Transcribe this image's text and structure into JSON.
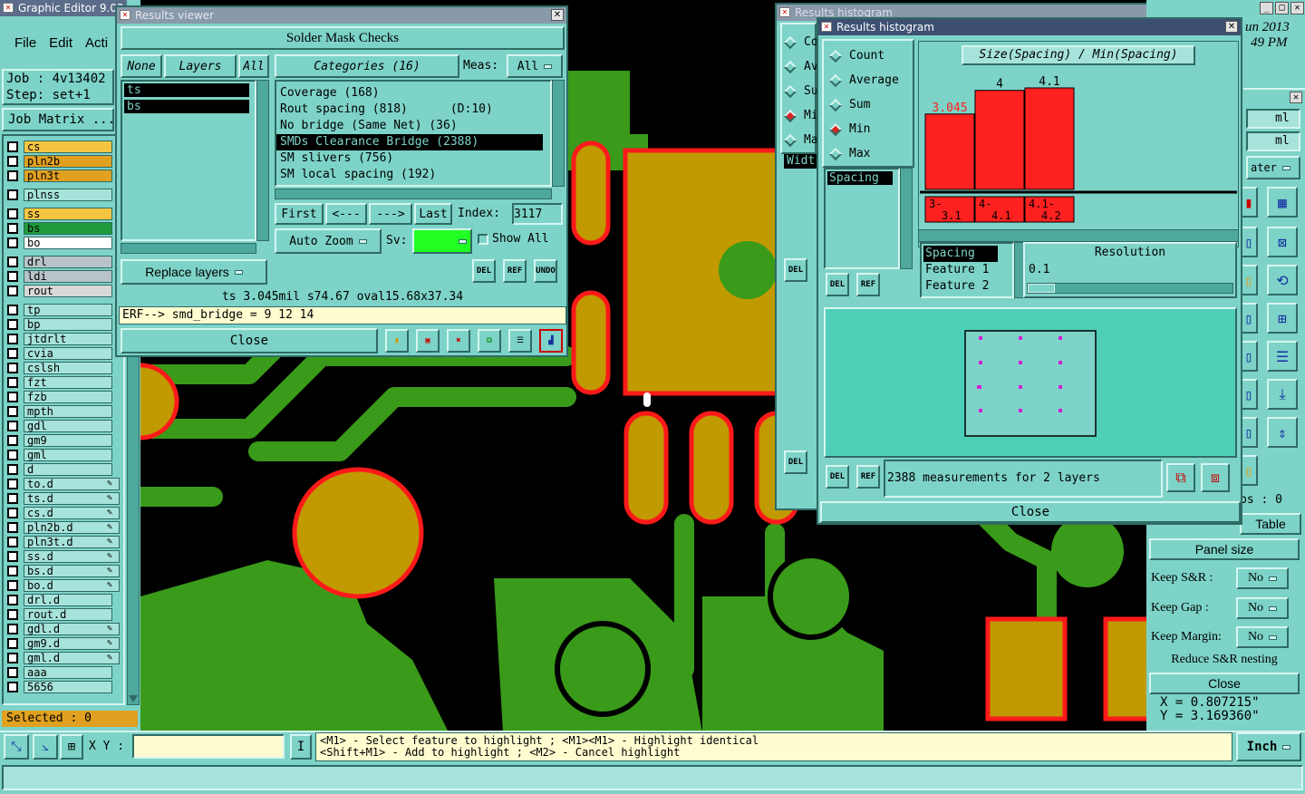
{
  "main": {
    "title": "Graphic Editor 9.02",
    "menu": [
      "File",
      "Edit",
      "Acti"
    ],
    "job": "Job : 4v13402",
    "step": "Step: set+1",
    "job_matrix": "Job Matrix ...",
    "selected": "Selected : 0",
    "xy_label": "X Y :",
    "xy_value": "",
    "hint1": "<M1> - Select feature to highlight ; <M1><M1> - Highlight identical",
    "hint2": "<Shift+M1> - Add to highlight ; <M2> - Cancel highlight",
    "units": "Inch",
    "date_frag": "un 2013",
    "time_frag": "49 PM"
  },
  "layers": [
    {
      "name": "cs",
      "color": "#f5c542"
    },
    {
      "name": "pln2b",
      "color": "#e0a020"
    },
    {
      "name": "pln3t",
      "color": "#e0a020"
    },
    {
      "name": "plnss",
      "color": "#a6e3da"
    },
    {
      "name": "ss",
      "color": "#f5c542"
    },
    {
      "name": "bs",
      "color": "#1e9a3c"
    },
    {
      "name": "bo",
      "color": "#ffffff"
    },
    {
      "name": "drl",
      "color": "#b8c4c8"
    },
    {
      "name": "ldi",
      "color": "#b8c4c8"
    },
    {
      "name": "rout",
      "color": "#d8d8d8"
    },
    {
      "name": "tp",
      "color": "#a6e3da"
    },
    {
      "name": "bp",
      "color": "#a6e3da"
    },
    {
      "name": "jtdrlt",
      "color": "#a6e3da"
    },
    {
      "name": "cvia",
      "color": "#a6e3da"
    },
    {
      "name": "cslsh",
      "color": "#a6e3da"
    },
    {
      "name": "fzt",
      "color": "#a6e3da"
    },
    {
      "name": "fzb",
      "color": "#a6e3da"
    },
    {
      "name": "mpth",
      "color": "#a6e3da"
    },
    {
      "name": "gdl",
      "color": "#a6e3da"
    },
    {
      "name": "gm9",
      "color": "#a6e3da"
    },
    {
      "name": "gml",
      "color": "#a6e3da"
    },
    {
      "name": "d",
      "color": "#a6e3da"
    },
    {
      "name": "to.d",
      "color": "#a6e3da",
      "tool": true
    },
    {
      "name": "ts.d",
      "color": "#a6e3da",
      "tool": true
    },
    {
      "name": "cs.d",
      "color": "#a6e3da",
      "tool": true
    },
    {
      "name": "pln2b.d",
      "color": "#a6e3da",
      "tool": true
    },
    {
      "name": "pln3t.d",
      "color": "#a6e3da",
      "tool": true
    },
    {
      "name": "ss.d",
      "color": "#a6e3da",
      "tool": true
    },
    {
      "name": "bs.d",
      "color": "#a6e3da",
      "tool": true
    },
    {
      "name": "bo.d",
      "color": "#a6e3da",
      "tool": true
    },
    {
      "name": "drl.d",
      "color": "#a6e3da"
    },
    {
      "name": "rout.d",
      "color": "#a6e3da"
    },
    {
      "name": "gdl.d",
      "color": "#a6e3da",
      "tool": true
    },
    {
      "name": "gm9.d",
      "color": "#a6e3da",
      "tool": true
    },
    {
      "name": "gml.d",
      "color": "#a6e3da",
      "tool": true
    },
    {
      "name": "aaa",
      "color": "#a6e3da"
    },
    {
      "name": "5656",
      "color": "#a6e3da"
    }
  ],
  "viewer": {
    "title": "Results viewer",
    "header": "Solder Mask Checks",
    "none": "None",
    "layers_btn": "Layers",
    "all": "All",
    "layer_list": [
      "ts",
      "bs"
    ],
    "categories": "Categories (16)",
    "meas_label": "Meas:",
    "meas_value": "All",
    "cat_list": [
      {
        "text": "Coverage (168)",
        "sel": false
      },
      {
        "text": "Rout spacing (818)      (D:10)",
        "sel": false
      },
      {
        "text": "No bridge (Same Net) (36)",
        "sel": false
      },
      {
        "text": "SMDs Clearance Bridge (2388)",
        "sel": true
      },
      {
        "text": "SM slivers (756)",
        "sel": false
      },
      {
        "text": "SM local spacing (192)",
        "sel": false
      }
    ],
    "first": "First",
    "prev": "<---",
    "next": "--->",
    "last": "Last",
    "index_label": "Index:",
    "index_value": "3117",
    "auto_zoom": "Auto Zoom",
    "sv_label": "Sv:",
    "show_all": "Show All",
    "replace_layers": "Replace layers",
    "del": "DEL",
    "ref": "REF",
    "undo": "UNDO",
    "info": "ts 3.045mil    s74.67    oval15.68x37.34",
    "erf": "ERF--> smd_bridge = 9 12 14",
    "close": "Close"
  },
  "bghist": {
    "title": "Results histogram",
    "items": [
      "Co",
      "Av",
      "Su",
      "Mi",
      "Ma"
    ],
    "widt": "Widt"
  },
  "hist": {
    "title": "Results histogram",
    "radios": [
      {
        "label": "Count",
        "on": false
      },
      {
        "label": "Average",
        "on": false
      },
      {
        "label": "Sum",
        "on": false
      },
      {
        "label": "Min",
        "on": true
      },
      {
        "label": "Max",
        "on": false
      }
    ],
    "field_list": [
      "Spacing"
    ],
    "feature_list": [
      "Spacing",
      "Feature 1",
      "Feature 2"
    ],
    "resolution_label": "Resolution",
    "resolution_value": "0.1",
    "measurements": "2388 measurements for 2 layers",
    "close": "Close",
    "del": "DEL",
    "ref": "REF"
  },
  "chart_data": {
    "type": "bar",
    "title": "Size(Spacing) / Min(Spacing)",
    "categories": [
      "3-\n3.1",
      "4-\n4.1",
      "4.1-\n4.2"
    ],
    "values": [
      3.045,
      4,
      4.1
    ],
    "value_labels": [
      "3.045",
      "4",
      "4.1"
    ],
    "bar_color": "#ff2020"
  },
  "right": {
    "ml1": "ml",
    "ml2": "ml",
    "ater": "ater",
    "table": "Table",
    "ps": "ps : 0",
    "panel_size": "Panel size",
    "keep_sr": "Keep S&R  :",
    "keep_sr_v": "No",
    "keep_gap": "Keep Gap   :",
    "keep_gap_v": "No",
    "keep_margin": "Keep Margin:",
    "keep_margin_v": "No",
    "reduce": "Reduce S&R nesting",
    "close": "Close",
    "x": "X  = 0.807215\"",
    "y": "Y  = 3.169360\""
  }
}
